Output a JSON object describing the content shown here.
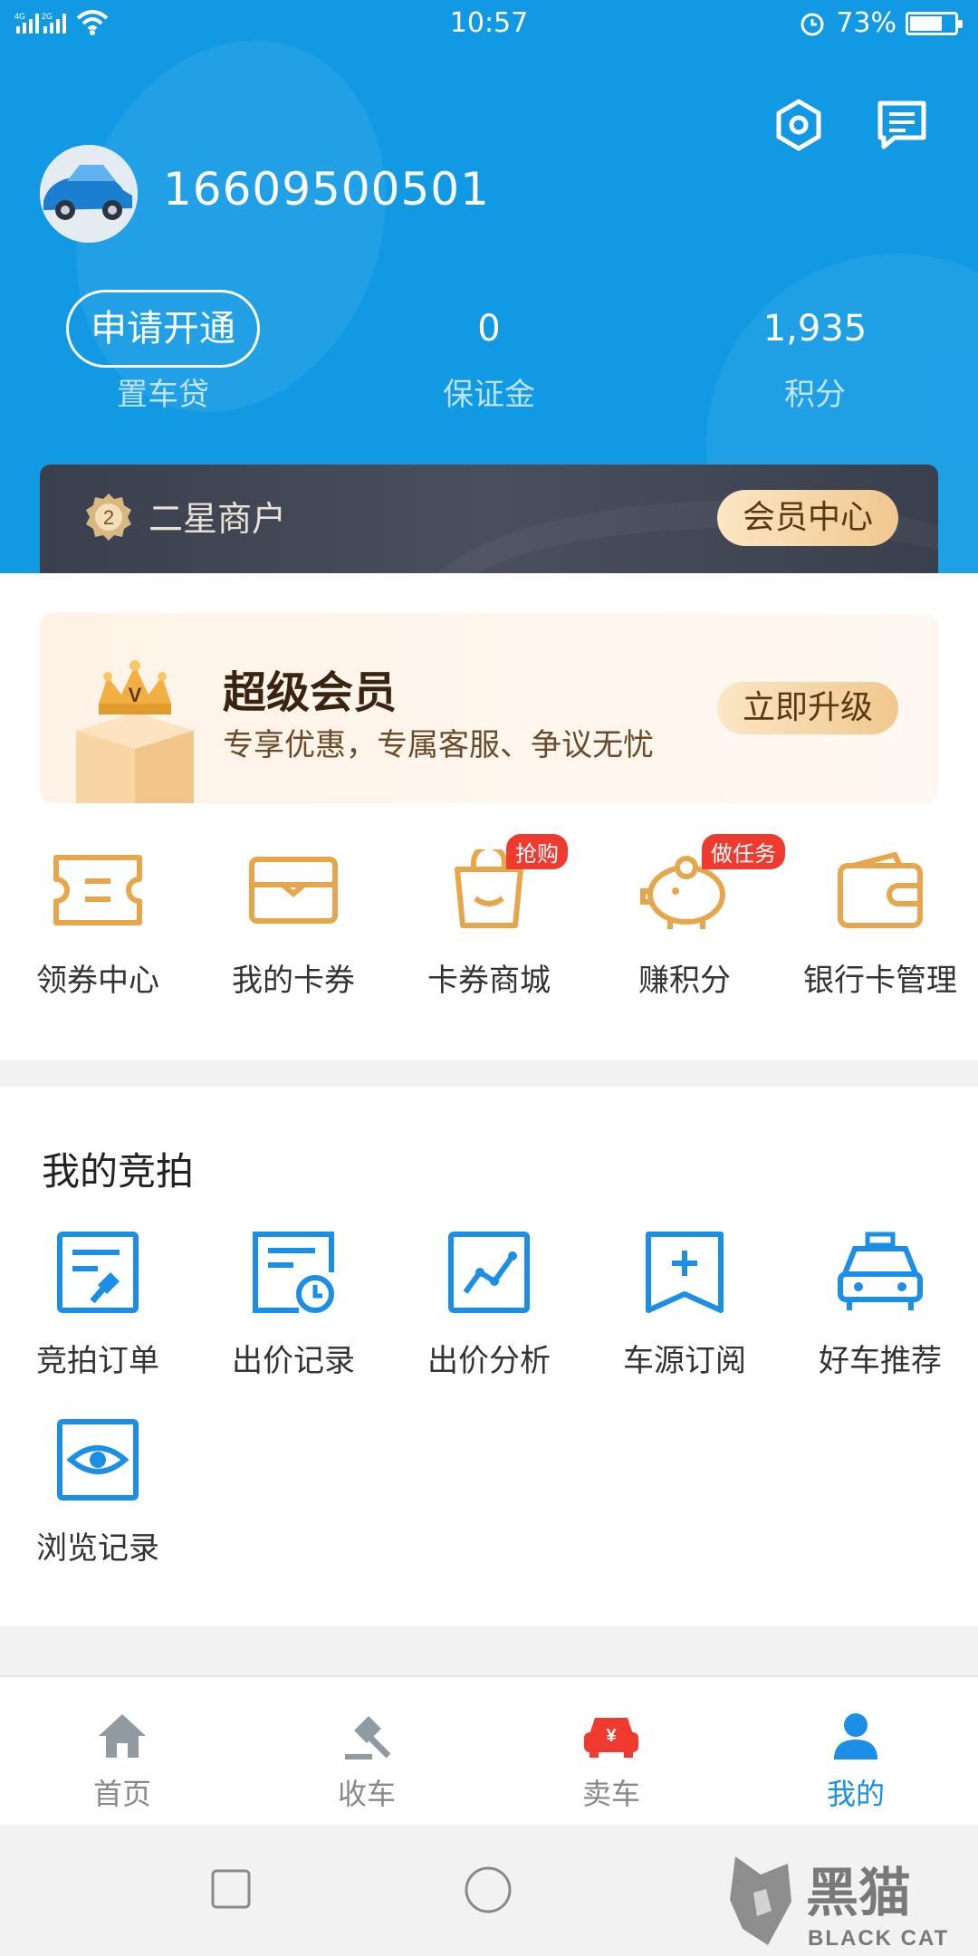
{
  "status_bar": {
    "time": "10:57",
    "battery": "73%",
    "battery_level": 0.73,
    "network": "4G 2G"
  },
  "header": {
    "phone": "16609500501",
    "apply_btn": "申请开通",
    "apply_sub": "置车贷",
    "deposit_value": "0",
    "deposit_label": "保证金",
    "points_value": "1,935",
    "points_label": "积分",
    "member_level": "二星商户",
    "member_center": "会员中心",
    "star_number": "2"
  },
  "super_member": {
    "title": "超级会员",
    "subtitle": "专享优惠，专属客服、争议无忧",
    "button": "立即升级"
  },
  "quick_links": [
    {
      "label": "领券中心",
      "icon": "ticket-icon"
    },
    {
      "label": "我的卡券",
      "icon": "card-icon"
    },
    {
      "label": "卡券商城",
      "icon": "shopping-bag-icon",
      "tag": "抢购"
    },
    {
      "label": "赚积分",
      "icon": "piggy-bank-icon",
      "tag": "做任务"
    },
    {
      "label": "银行卡管理",
      "icon": "wallet-icon"
    }
  ],
  "auction": {
    "title": "我的竞拍",
    "items": [
      {
        "label": "竞拍订单",
        "icon": "auction-order-icon"
      },
      {
        "label": "出价记录",
        "icon": "bid-record-icon"
      },
      {
        "label": "出价分析",
        "icon": "bid-analysis-icon"
      },
      {
        "label": "车源订阅",
        "icon": "subscribe-icon"
      },
      {
        "label": "好车推荐",
        "icon": "car-recommend-icon"
      },
      {
        "label": "浏览记录",
        "icon": "eye-icon"
      }
    ]
  },
  "tabs": [
    {
      "label": "首页",
      "icon": "home-icon"
    },
    {
      "label": "收车",
      "icon": "gavel-icon"
    },
    {
      "label": "卖车",
      "icon": "sell-car-icon",
      "icon_text": "¥"
    },
    {
      "label": "我的",
      "icon": "profile-icon",
      "active": true
    }
  ],
  "colors": {
    "header": "#1199e3",
    "accent": "#1b8ee6",
    "gold": "#e8b060",
    "tag_red": "#ef3a2f"
  },
  "watermark": {
    "cn": "黑猫",
    "en": "BLACK CAT"
  }
}
